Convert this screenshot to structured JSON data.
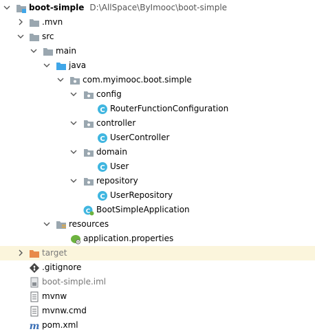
{
  "project": {
    "name": "boot-simple",
    "path": "D:\\AllSpace\\ByImooc\\boot-simple"
  },
  "tree": {
    "mvn": ".mvn",
    "src": "src",
    "main": "main",
    "java": "java",
    "package": "com.myimooc.boot.simple",
    "config": "config",
    "router_function_configuration": "RouterFunctionConfiguration",
    "controller": "controller",
    "user_controller": "UserController",
    "domain": "domain",
    "user": "User",
    "repository": "repository",
    "user_repository": "UserRepository",
    "boot_simple_application": "BootSimpleApplication",
    "resources": "resources",
    "application_properties": "application.properties",
    "target": "target",
    "gitignore": ".gitignore",
    "iml": "boot-simple.iml",
    "mvnw": "mvnw",
    "mvnw_cmd": "mvnw.cmd",
    "pom": "pom.xml"
  },
  "colors": {
    "folder": "#9aa7b0",
    "source_folder": "#40a6e8",
    "class_icon": "#40b6e0",
    "excluded_folder": "#e8894a",
    "highlight_row": "#fbf5dc"
  }
}
